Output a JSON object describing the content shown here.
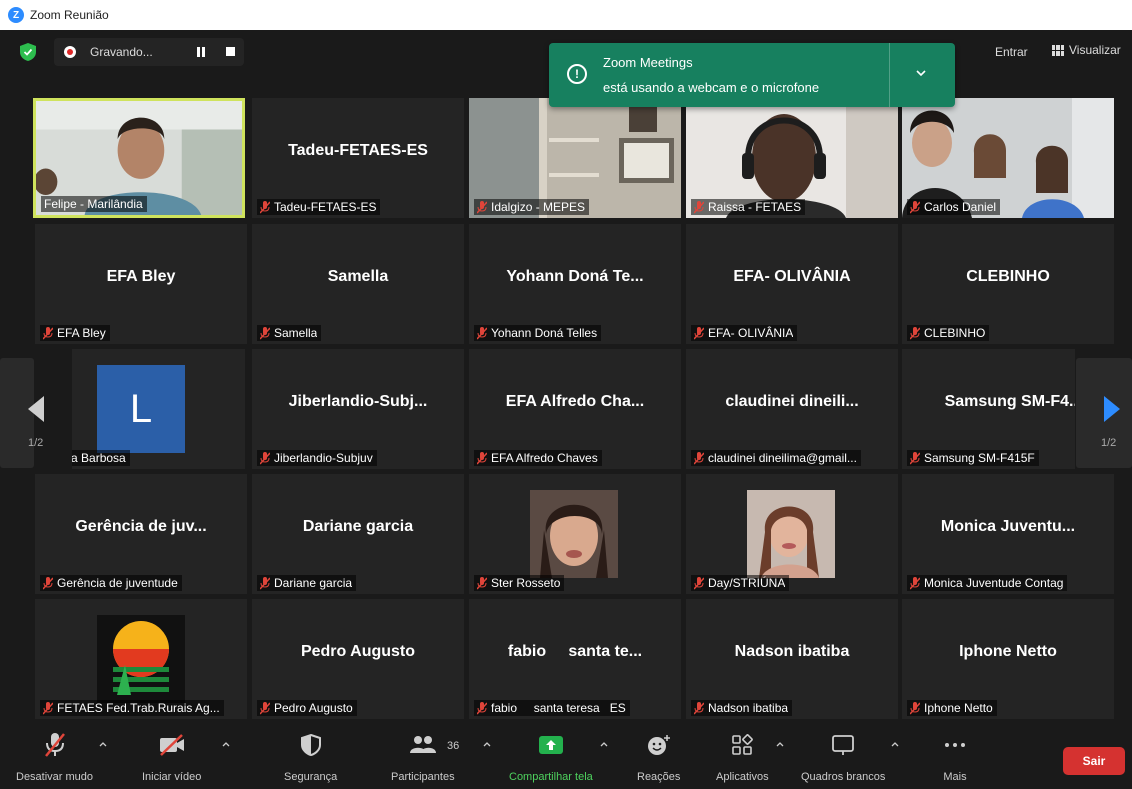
{
  "window": {
    "title": "Zoom Reunião"
  },
  "recording": {
    "label": "Gravando..."
  },
  "notification": {
    "title": "Zoom Meetings",
    "message": "está usando a webcam e o microfone"
  },
  "topbar": {
    "enter_label": "Entrar",
    "view_label": "Visualizar"
  },
  "pager": {
    "left": "1/2",
    "right": "1/2"
  },
  "tiles": [
    {
      "label": "Felipe - Marilândia"
    },
    {
      "display": "Tadeu-FETAES-ES",
      "label": "Tadeu-FETAES-ES"
    },
    {
      "label": "Idalgizo - MEPES"
    },
    {
      "label": "Raissa - FETAES"
    },
    {
      "label": "Carlos Daniel"
    },
    {
      "display": "EFA Bley",
      "label": "EFA Bley"
    },
    {
      "display": "Samella",
      "label": "Samella"
    },
    {
      "display": "Yohann Doná Te...",
      "label": "Yohann Doná Telles"
    },
    {
      "display": "EFA- OLIVÂNIA",
      "label": "EFA- OLIVÂNIA"
    },
    {
      "display": "CLEBINHO",
      "label": "CLEBINHO"
    },
    {
      "avatar_letter": "L",
      "label": "Larissa Barbosa"
    },
    {
      "display": "Jiberlandio-Subj...",
      "label": "Jiberlandio-Subjuv"
    },
    {
      "display": "EFA Alfredo Cha...",
      "label": "EFA Alfredo Chaves"
    },
    {
      "display": "claudinei dineili...",
      "label": "claudinei dineilima@gmail..."
    },
    {
      "display": "Samsung SM-F4...",
      "label": "Samsung SM-F415F"
    },
    {
      "display": "Gerência de juv...",
      "label": "Gerência de juventude"
    },
    {
      "display": "Dariane garcia",
      "label": "Dariane garcia"
    },
    {
      "label": "Ster Rosseto"
    },
    {
      "label": "Day/STRIÚNA"
    },
    {
      "display": "Monica Juventu...",
      "label": "Monica Juventude Contag"
    },
    {
      "label": "FETAES Fed.Trab.Rurais Ag..."
    },
    {
      "display": "Pedro Augusto",
      "label": "Pedro Augusto"
    },
    {
      "display": "fabio     santa te...",
      "label": "fabio     santa teresa   ES"
    },
    {
      "display": "Nadson ibatiba",
      "label": "Nadson ibatiba"
    },
    {
      "display": "Iphone Netto",
      "label": "Iphone Netto"
    }
  ],
  "toolbar": {
    "mute": "Desativar mudo",
    "video": "Iniciar vídeo",
    "security": "Segurança",
    "participants": "Participantes",
    "participants_count": "36",
    "share": "Compartilhar tela",
    "reactions": "Reações",
    "apps": "Aplicativos",
    "whiteboards": "Quadros brancos",
    "more": "Mais",
    "leave": "Sair"
  },
  "colors": {
    "notification_bg": "#17805f",
    "active_speaker": "#cfe35d",
    "share_green": "#23b14d",
    "leave_red": "#d53230",
    "avatar_blue": "#2b5fa8"
  }
}
